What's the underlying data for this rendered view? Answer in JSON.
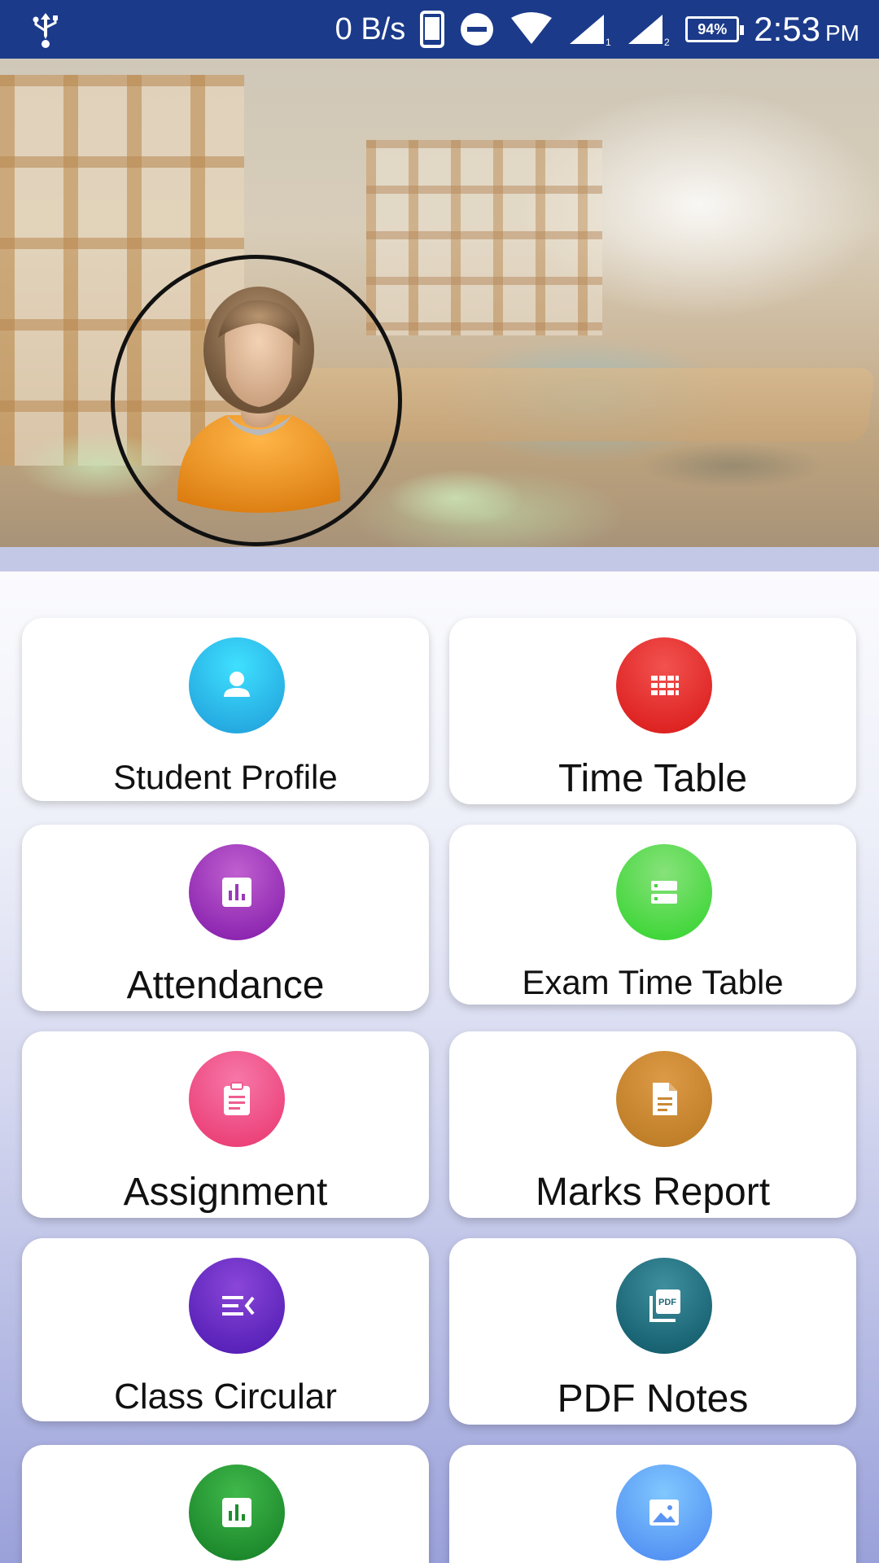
{
  "status_bar": {
    "net_speed": "0 B/s",
    "battery": "94%",
    "time": "2:53",
    "ampm": "PM"
  },
  "header": {
    "avatar": "student-avatar"
  },
  "menu": {
    "items": [
      {
        "label": "Student Profile",
        "icon": "person-icon",
        "color": "#1e9bd8"
      },
      {
        "label": "Time Table",
        "icon": "grid-calendar-icon",
        "color": "#d81616"
      },
      {
        "label": "Attendance",
        "icon": "bar-chart-icon",
        "color": "#7f18a8"
      },
      {
        "label": "Exam Time Table",
        "icon": "list-rows-icon",
        "color": "#2fd32a"
      },
      {
        "label": "Assignment",
        "icon": "clipboard-icon",
        "color": "#e8346d"
      },
      {
        "label": "Marks Report",
        "icon": "document-icon",
        "color": "#b87721"
      },
      {
        "label": "Class Circular",
        "icon": "menu-arrow-icon",
        "color": "#4b18b0"
      },
      {
        "label": "PDF Notes",
        "icon": "pdf-icon",
        "color": "#0d5565"
      },
      {
        "label": "",
        "icon": "bar-chart-icon",
        "color": "#137c24"
      },
      {
        "label": "",
        "icon": "image-icon",
        "color": "#4a86f0"
      }
    ]
  }
}
